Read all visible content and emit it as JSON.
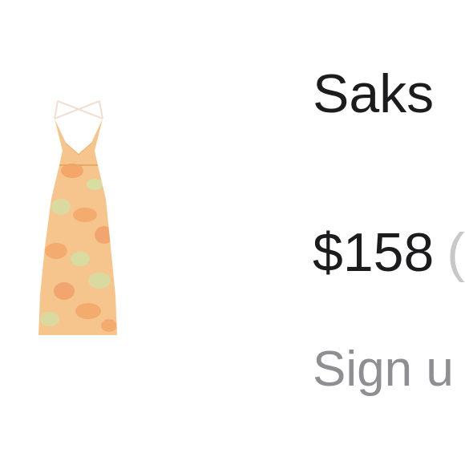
{
  "product": {
    "image_icon": "dress-product-image",
    "retailer": "Saks",
    "price": "$158",
    "price_extra": "(",
    "signup_text": "Sign u"
  },
  "colors": {
    "text_primary": "#1c1c1e",
    "text_secondary": "#8e8e93",
    "dress_base": "#f6c58d",
    "dress_print_orange": "#f39a5a",
    "dress_print_green": "#cfe3a8"
  }
}
